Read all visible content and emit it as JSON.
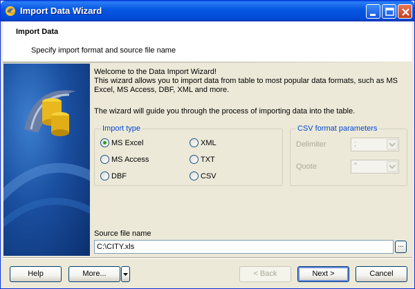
{
  "window": {
    "title": "Import Data Wizard"
  },
  "header": {
    "title": "Import Data",
    "subtitle": "Specify import format and source file name"
  },
  "welcome": {
    "line1": "Welcome to the Data Import Wizard!",
    "line2": "This wizard allows you to import data from table to most popular data formats, such as MS",
    "line3": "Excel, MS Access, DBF, XML and more.",
    "guide": "The wizard will guide you through the process of importing data into the table."
  },
  "import_type": {
    "legend": "Import type",
    "selected": "MS Excel",
    "options": [
      "MS Excel",
      "MS Access",
      "DBF",
      "XML",
      "TXT",
      "CSV"
    ]
  },
  "csv_params": {
    "legend": "CSV format parameters",
    "delimiter_label": "Delimiter",
    "delimiter_value": ";",
    "quote_label": "Quote",
    "quote_value": "\""
  },
  "source": {
    "label": "Source file name",
    "value": "C:\\CITY.xls",
    "browse_label": "..."
  },
  "buttons": {
    "help": "Help",
    "more": "More...",
    "back": "< Back",
    "next": "Next >",
    "cancel": "Cancel"
  },
  "colors": {
    "titlebar": "#0058e6",
    "legend": "#0046d5",
    "radio_dot": "#21a121"
  }
}
